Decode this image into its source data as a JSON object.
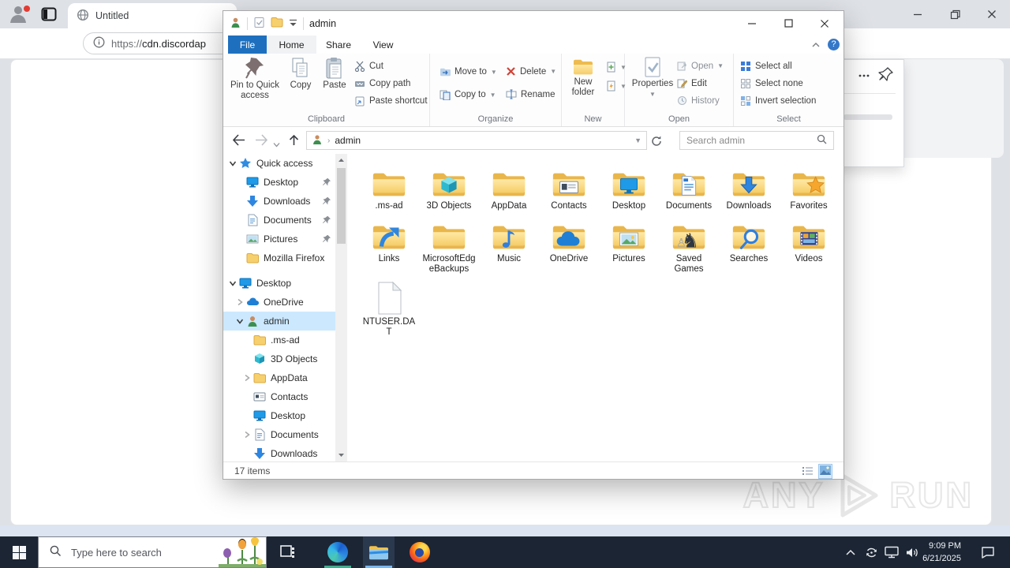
{
  "browser": {
    "tab_title": "Untitled",
    "url_scheme": "https://",
    "url_host": "cdn.discordap"
  },
  "watermark": {
    "left": "ANY",
    "right": "RUN"
  },
  "explorer": {
    "title": "admin",
    "tabs": {
      "file": "File",
      "home": "Home",
      "share": "Share",
      "view": "View"
    },
    "ribbon": {
      "pin_to_quick": "Pin to Quick access",
      "copy": "Copy",
      "paste": "Paste",
      "cut": "Cut",
      "copy_path": "Copy path",
      "paste_shortcut": "Paste shortcut",
      "move_to": "Move to",
      "copy_to": "Copy to",
      "delete": "Delete",
      "rename": "Rename",
      "new_folder": "New folder",
      "properties": "Properties",
      "open": "Open",
      "edit": "Edit",
      "history": "History",
      "select_all": "Select all",
      "select_none": "Select none",
      "invert_selection": "Invert selection",
      "groups": {
        "clipboard": "Clipboard",
        "organize": "Organize",
        "new": "New",
        "open": "Open",
        "select": "Select"
      }
    },
    "nav": {
      "breadcrumb": "admin",
      "search_placeholder": "Search admin"
    },
    "sidebar": [
      {
        "label": "Quick access",
        "icon": "star",
        "depth": 0,
        "expander": "open"
      },
      {
        "label": "Desktop",
        "icon": "monitor",
        "depth": 1,
        "pinned": true
      },
      {
        "label": "Downloads",
        "icon": "down",
        "depth": 1,
        "pinned": true
      },
      {
        "label": "Documents",
        "icon": "doc",
        "depth": 1,
        "pinned": true
      },
      {
        "label": "Pictures",
        "icon": "pic",
        "depth": 1,
        "pinned": true
      },
      {
        "label": "Mozilla Firefox",
        "icon": "folder",
        "depth": 1
      },
      {
        "label": "Desktop",
        "icon": "monitor",
        "depth": 0,
        "expander": "open",
        "gap": true
      },
      {
        "label": "OneDrive",
        "icon": "cloud",
        "depth": 1,
        "expander": "closed"
      },
      {
        "label": "admin",
        "icon": "person",
        "depth": 1,
        "expander": "open",
        "selected": true
      },
      {
        "label": ".ms-ad",
        "icon": "folder",
        "depth": 2
      },
      {
        "label": "3D Objects",
        "icon": "cube",
        "depth": 2
      },
      {
        "label": "AppData",
        "icon": "folder",
        "depth": 2,
        "expander": "closed"
      },
      {
        "label": "Contacts",
        "icon": "card",
        "depth": 2
      },
      {
        "label": "Desktop",
        "icon": "monitor",
        "depth": 2
      },
      {
        "label": "Documents",
        "icon": "doc",
        "depth": 2,
        "expander": "closed"
      },
      {
        "label": "Downloads",
        "icon": "down",
        "depth": 2
      }
    ],
    "files": [
      {
        "name": ".ms-ad",
        "icon": "folder"
      },
      {
        "name": "3D Objects",
        "icon": "cube"
      },
      {
        "name": "AppData",
        "icon": "folder"
      },
      {
        "name": "Contacts",
        "icon": "card"
      },
      {
        "name": "Desktop",
        "icon": "monitor"
      },
      {
        "name": "Documents",
        "icon": "docpage"
      },
      {
        "name": "Downloads",
        "icon": "down"
      },
      {
        "name": "Favorites",
        "icon": "star"
      },
      {
        "name": "Links",
        "icon": "link"
      },
      {
        "name": "MicrosoftEdgeBackups",
        "icon": "folder"
      },
      {
        "name": "Music",
        "icon": "note"
      },
      {
        "name": "OneDrive",
        "icon": "cloud"
      },
      {
        "name": "Pictures",
        "icon": "pic"
      },
      {
        "name": "Saved Games",
        "icon": "knight"
      },
      {
        "name": "Searches",
        "icon": "magnifier"
      },
      {
        "name": "Videos",
        "icon": "film"
      },
      {
        "name": "NTUSER.DAT",
        "icon": "file"
      }
    ],
    "status_text": "17 items"
  },
  "taskbar": {
    "search_placeholder": "Type here to search",
    "time": "9:09 PM",
    "date": "6/21/2025"
  }
}
